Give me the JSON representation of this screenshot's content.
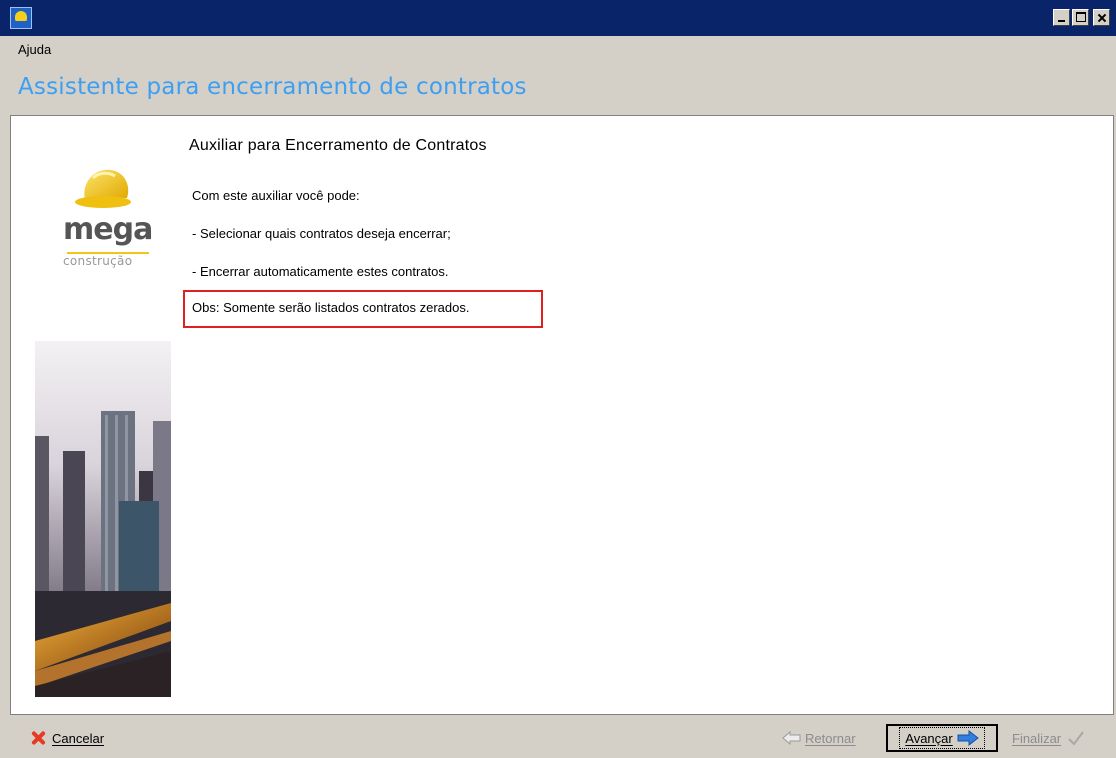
{
  "menu": {
    "ajuda": "Ajuda"
  },
  "page": {
    "heading": "Assistente para encerramento de contratos"
  },
  "logo": {
    "name": "mega",
    "sub": "construção"
  },
  "content": {
    "title": "Auxiliar para Encerramento de Contratos",
    "lines": [
      "Com este auxiliar você pode:",
      "- Selecionar quais contratos deseja encerrar;",
      "- Encerrar automaticamente estes contratos.",
      "Obs: Somente serão listados contratos zerados."
    ]
  },
  "buttons": {
    "cancel": "Cancelar",
    "back": "Retornar",
    "next": "Avançar",
    "finish": "Finalizar"
  },
  "colors": {
    "title_bar": "#0a246a",
    "heading": "#3d9ff2",
    "highlight_box": "#e02020",
    "cancel_icon": "#e53a24"
  }
}
